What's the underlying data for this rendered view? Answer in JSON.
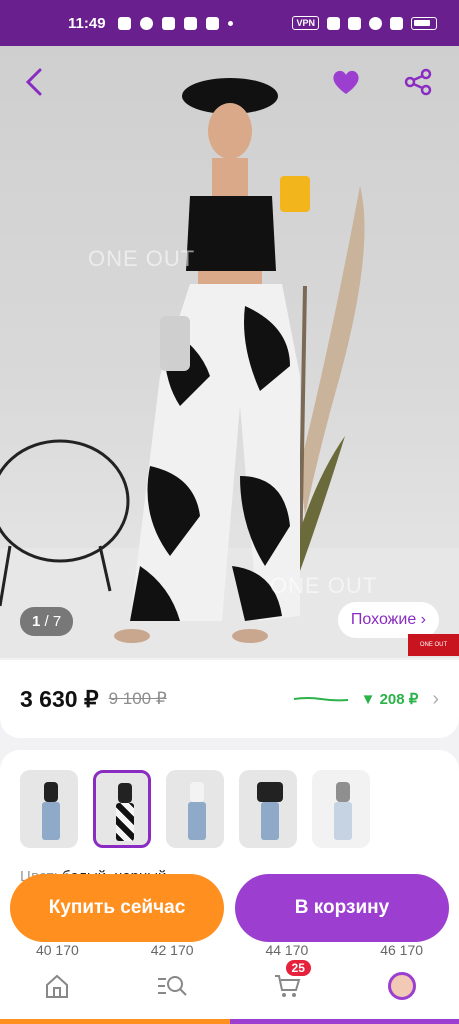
{
  "status": {
    "time": "11:49",
    "vpn": "VPN"
  },
  "hero": {
    "watermark": "ONE OUT",
    "counter_current": "1",
    "counter_total": "/ 7",
    "similar_label": "Похожие ›",
    "brand_tag": "ONE OUT"
  },
  "price": {
    "current": "3 630 ₽",
    "old": "9 100 ₽",
    "drop": "▼ 208 ₽"
  },
  "colors": {
    "label_prefix": "Цвет:",
    "value": "белый, черный"
  },
  "sizes": [
    "40 170",
    "42 170",
    "44 170",
    "46 170"
  ],
  "actions": {
    "buy_now": "Купить сейчас",
    "add_to_cart": "В корзину"
  },
  "nav": {
    "cart_badge": "25"
  },
  "theme": {
    "accent": "#9c3fd1",
    "orange": "#ff8f1f",
    "statusbar": "#6a1f8e"
  }
}
